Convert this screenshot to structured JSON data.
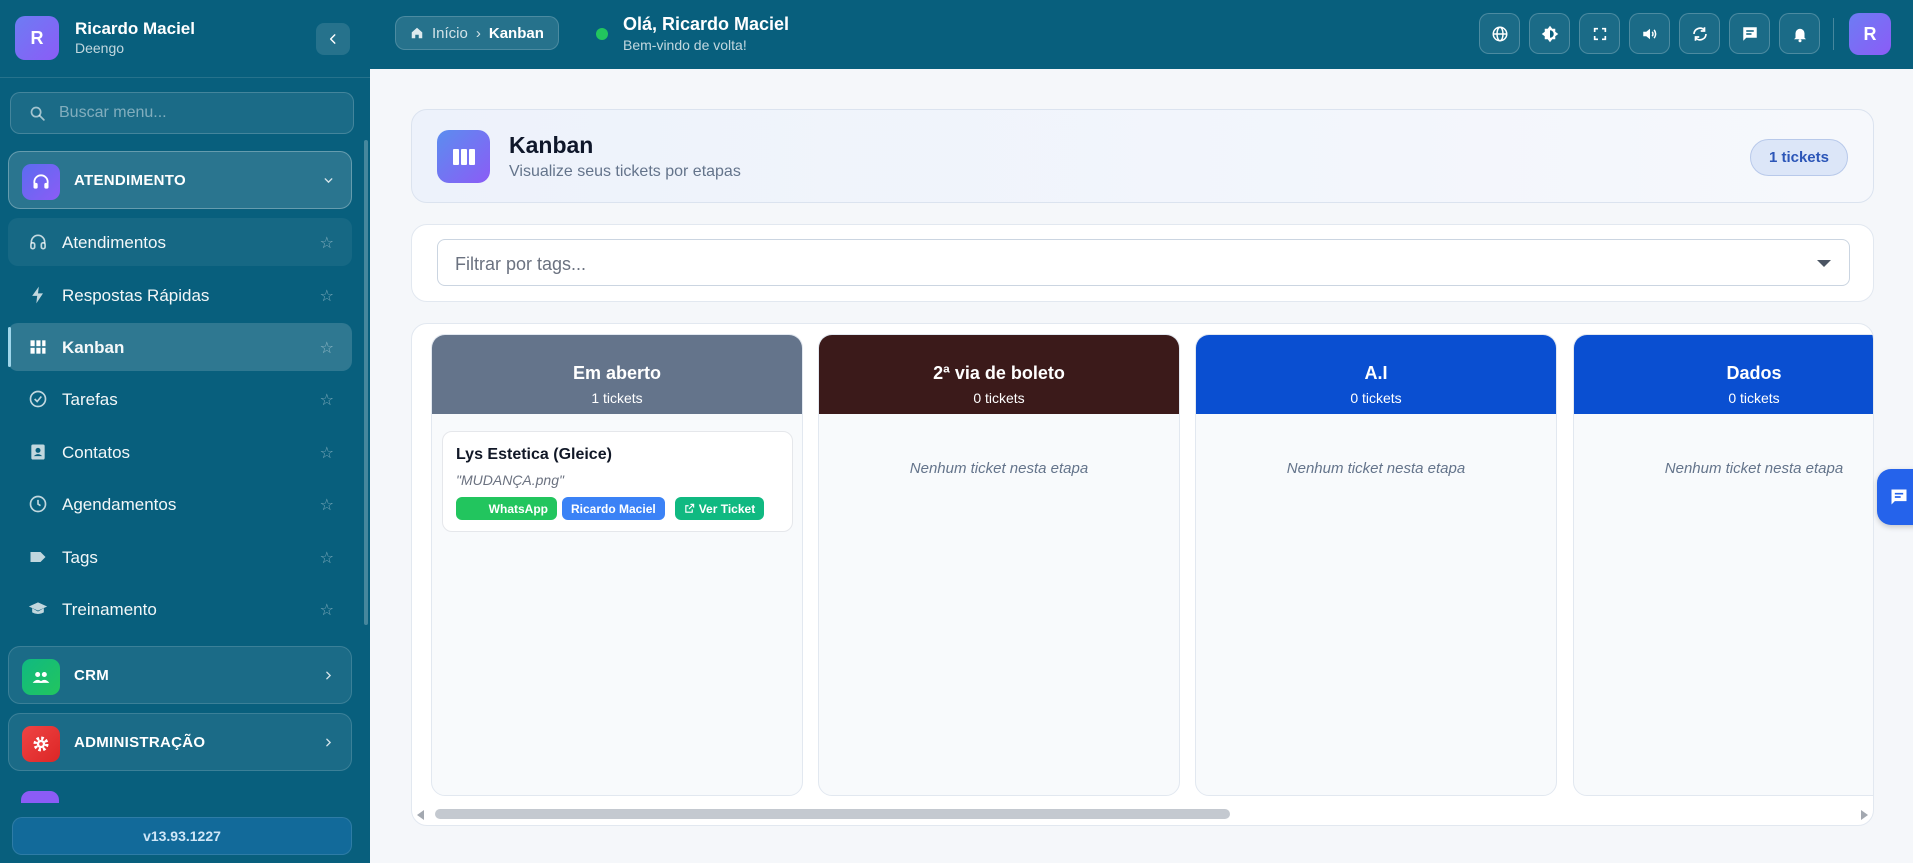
{
  "user": {
    "initial": "R",
    "name": "Ricardo Maciel",
    "company": "Deengo"
  },
  "sidebar": {
    "search_placeholder": "Buscar menu...",
    "groups": [
      {
        "label": "ATENDIMENTO",
        "color": "#6366f1",
        "icon": "headset-icon",
        "expanded": true
      },
      {
        "label": "CRM",
        "color": "#10b981",
        "icon": "people-icon",
        "expanded": false
      },
      {
        "label": "ADMINISTRAÇÃO",
        "color": "#ef4444",
        "icon": "gear-icon",
        "expanded": false
      }
    ],
    "items": [
      {
        "label": "Atendimentos",
        "icon": "headset-icon"
      },
      {
        "label": "Respostas Rápidas",
        "icon": "bolt-icon"
      },
      {
        "label": "Kanban",
        "icon": "grid-icon",
        "active": true
      },
      {
        "label": "Tarefas",
        "icon": "check-circle-icon"
      },
      {
        "label": "Contatos",
        "icon": "contact-card-icon"
      },
      {
        "label": "Agendamentos",
        "icon": "clock-icon"
      },
      {
        "label": "Tags",
        "icon": "tag-icon"
      },
      {
        "label": "Treinamento",
        "icon": "school-icon"
      }
    ],
    "version": "v13.93.1227"
  },
  "topbar": {
    "breadcrumb": {
      "home": "Início",
      "separator": "›",
      "current": "Kanban"
    },
    "greeting": {
      "title": "Olá, Ricardo Maciel",
      "subtitle": "Bem-vindo de volta!"
    },
    "actions": [
      "globe-icon",
      "brightness-icon",
      "fullscreen-icon",
      "volume-icon",
      "refresh-icon",
      "chat-icon",
      "bell-icon"
    ]
  },
  "page": {
    "title": "Kanban",
    "subtitle": "Visualize seus tickets por etapas",
    "badge": "1 tickets",
    "filter_placeholder": "Filtrar por tags..."
  },
  "kanban": {
    "empty_text": "Nenhum ticket nesta etapa",
    "columns": [
      {
        "name": "Em aberto",
        "count": "1 tickets",
        "color": "#64748b"
      },
      {
        "name": "2ª via de boleto",
        "count": "0 tickets",
        "color": "#3b1a1a"
      },
      {
        "name": "A.I",
        "count": "0 tickets",
        "color": "#0a4fd1"
      },
      {
        "name": "Dados",
        "count": "0 tickets",
        "color": "#0a4fd1"
      }
    ],
    "ticket": {
      "title": "Lys Estetica (Gleice)",
      "message": "\"MUDANÇA.png\"",
      "tags": [
        {
          "label": "WhatsApp",
          "color": "#22c55e"
        },
        {
          "label": "Ricardo Maciel",
          "color": "#3b82f6"
        },
        {
          "label": "Ver Ticket",
          "color": "#10b981"
        }
      ]
    }
  }
}
